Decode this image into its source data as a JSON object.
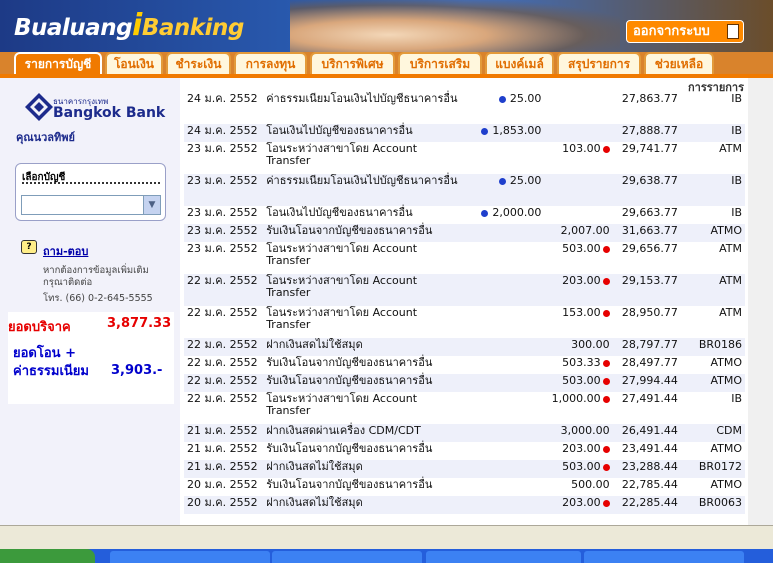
{
  "app": {
    "logo_main": "Bualuang",
    "logo_i": "i",
    "logo_banking": "Banking",
    "logout_label": "ออกจากระบบ"
  },
  "tabs": [
    {
      "label": "รายการบัญชี",
      "active": true
    },
    {
      "label": "โอนเงิน"
    },
    {
      "label": "ชำระเงิน"
    },
    {
      "label": "การลงทุน"
    },
    {
      "label": "บริการพิเศษ"
    },
    {
      "label": "บริการเสริม"
    },
    {
      "label": "แบงค์เมล์"
    },
    {
      "label": "สรุปรายการ"
    },
    {
      "label": "ช่วยเหลือ"
    }
  ],
  "sidebar": {
    "bank_name_th": "ธนาคารกรุงเทพ",
    "bank_name_en": "Bangkok Bank",
    "member": "คุณนวลทิพย์",
    "account_label": "เลือกบัญชี",
    "account_value": "",
    "qa_icon": "?",
    "qa_link": "ถาม-ตอบ",
    "help_text": "หากต้องการข้อมูลเพิ่มเติม กรุณาติดต่อ",
    "help_phone": "โทร. (66) 0-2-645-5555",
    "summary1_label": "ยอดบริจาค",
    "summary1_value": "3,877.33",
    "summary2_label_line1": "ยอดโอน +",
    "summary2_label_line2": "ค่าธรรมเนียม",
    "summary2_value": "3,903.-"
  },
  "table": {
    "channel_header": "การรายการ",
    "rows": [
      {
        "date": "24 ม.ค. 2552",
        "desc": "ค่าธรรมเนียมโอนเงินไปบัญชีธนาคารอื่น",
        "withdraw": "25.00",
        "deposit": "",
        "balance": "27,863.77",
        "channel": "IB",
        "wmark": true,
        "dmark": false,
        "tall": true
      },
      {
        "date": "24 ม.ค. 2552",
        "desc": "โอนเงินไปบัญชีของธนาคารอื่น",
        "withdraw": "1,853.00",
        "deposit": "",
        "balance": "27,888.77",
        "channel": "IB",
        "wmark": true,
        "dmark": false
      },
      {
        "date": "23 ม.ค. 2552",
        "desc": "โอนระหว่างสาขาโดย Account Transfer",
        "withdraw": "",
        "deposit": "103.00",
        "balance": "29,741.77",
        "channel": "ATM",
        "wmark": false,
        "dmark": true,
        "tall": true
      },
      {
        "date": "23 ม.ค. 2552",
        "desc": "ค่าธรรมเนียมโอนเงินไปบัญชีธนาคารอื่น",
        "withdraw": "25.00",
        "deposit": "",
        "balance": "29,638.77",
        "channel": "IB",
        "wmark": true,
        "dmark": false,
        "tall": true
      },
      {
        "date": "23 ม.ค. 2552",
        "desc": "โอนเงินไปบัญชีของธนาคารอื่น",
        "withdraw": "2,000.00",
        "deposit": "",
        "balance": "29,663.77",
        "channel": "IB",
        "wmark": true,
        "dmark": false
      },
      {
        "date": "23 ม.ค. 2552",
        "desc": "รับเงินโอนจากบัญชีของธนาคารอื่น",
        "withdraw": "",
        "deposit": "2,007.00",
        "balance": "31,663.77",
        "channel": "ATMO",
        "wmark": false,
        "dmark": false
      },
      {
        "date": "23 ม.ค. 2552",
        "desc": "โอนระหว่างสาขาโดย Account Transfer",
        "withdraw": "",
        "deposit": "503.00",
        "balance": "29,656.77",
        "channel": "ATM",
        "wmark": false,
        "dmark": true,
        "tall": true
      },
      {
        "date": "22 ม.ค. 2552",
        "desc": "โอนระหว่างสาขาโดย Account Transfer",
        "withdraw": "",
        "deposit": "203.00",
        "balance": "29,153.77",
        "channel": "ATM",
        "wmark": false,
        "dmark": true,
        "tall": true
      },
      {
        "date": "22 ม.ค. 2552",
        "desc": "โอนระหว่างสาขาโดย Account Transfer",
        "withdraw": "",
        "deposit": "153.00",
        "balance": "28,950.77",
        "channel": "ATM",
        "wmark": false,
        "dmark": true,
        "tall": true
      },
      {
        "date": "22 ม.ค. 2552",
        "desc": "ฝากเงินสดไม่ใช้สมุด",
        "withdraw": "",
        "deposit": "300.00",
        "balance": "28,797.77",
        "channel": "BR0186",
        "wmark": false,
        "dmark": false
      },
      {
        "date": "22 ม.ค. 2552",
        "desc": "รับเงินโอนจากบัญชีของธนาคารอื่น",
        "withdraw": "",
        "deposit": "503.33",
        "balance": "28,497.77",
        "channel": "ATMO",
        "wmark": false,
        "dmark": true
      },
      {
        "date": "22 ม.ค. 2552",
        "desc": "รับเงินโอนจากบัญชีของธนาคารอื่น",
        "withdraw": "",
        "deposit": "503.00",
        "balance": "27,994.44",
        "channel": "ATMO",
        "wmark": false,
        "dmark": true
      },
      {
        "date": "22 ม.ค. 2552",
        "desc": "โอนระหว่างสาขาโดย Account Transfer",
        "withdraw": "",
        "deposit": "1,000.00",
        "balance": "27,491.44",
        "channel": "IB",
        "wmark": false,
        "dmark": true,
        "tall": true
      },
      {
        "date": "21 ม.ค. 2552",
        "desc": "ฝากเงินสดผ่านเครื่อง CDM/CDT",
        "withdraw": "",
        "deposit": "3,000.00",
        "balance": "26,491.44",
        "channel": "CDM",
        "wmark": false,
        "dmark": false
      },
      {
        "date": "21 ม.ค. 2552",
        "desc": "รับเงินโอนจากบัญชีของธนาคารอื่น",
        "withdraw": "",
        "deposit": "203.00",
        "balance": "23,491.44",
        "channel": "ATMO",
        "wmark": false,
        "dmark": true
      },
      {
        "date": "21 ม.ค. 2552",
        "desc": "ฝากเงินสดไม่ใช้สมุด",
        "withdraw": "",
        "deposit": "503.00",
        "balance": "23,288.44",
        "channel": "BR0172",
        "wmark": false,
        "dmark": true
      },
      {
        "date": "20 ม.ค. 2552",
        "desc": "รับเงินโอนจากบัญชีของธนาคารอื่น",
        "withdraw": "",
        "deposit": "500.00",
        "balance": "22,785.44",
        "channel": "ATMO",
        "wmark": false,
        "dmark": false
      },
      {
        "date": "20 ม.ค. 2552",
        "desc": "ฝากเงินสดไม่ใช้สมุด",
        "withdraw": "",
        "deposit": "203.00",
        "balance": "22,285.44",
        "channel": "BR0063",
        "wmark": false,
        "dmark": true
      }
    ]
  },
  "colors": {
    "brand_orange": "#f07a00",
    "brand_navy": "#1d2b8c",
    "mark_blue": "#1f3fcc",
    "mark_red": "#e60000"
  }
}
